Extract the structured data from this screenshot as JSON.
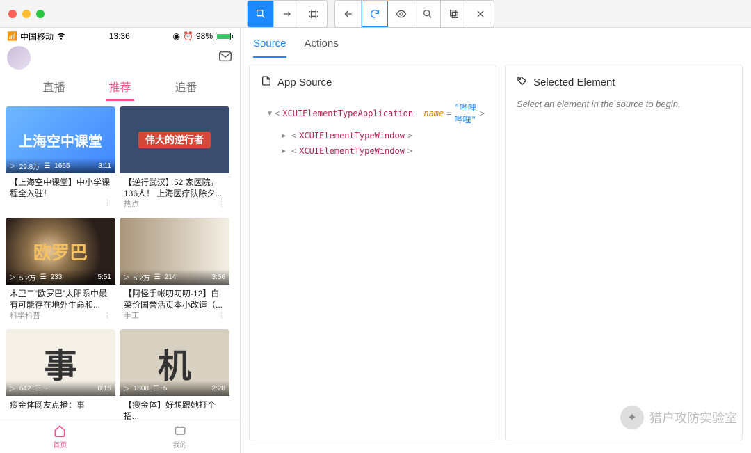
{
  "status": {
    "carrier": "中国移动",
    "time": "13:36",
    "battery_pct": "98%"
  },
  "phone_tabs": {
    "live": "直播",
    "rec": "推荐",
    "follow": "追番"
  },
  "cards": [
    {
      "thumb_text": "上海空中课堂",
      "views": "29.8万",
      "comments": "1665",
      "dur": "3:11",
      "title": "【上海空中课堂】中小学课程全入驻！",
      "sub": ""
    },
    {
      "banner": "伟大的逆行者",
      "views": "",
      "comments": "",
      "dur": "",
      "title": "【逆行武汉】52 家医院，136人！ 上海医疗队除夕...",
      "sub": "热点"
    },
    {
      "thumb_text": "欧罗巴",
      "views": "5.2万",
      "comments": "233",
      "dur": "5:51",
      "title": "木卫二“欧罗巴”太阳系中最有可能存在地外生命和...",
      "sub": "科学科普"
    },
    {
      "views": "5.2万",
      "comments": "214",
      "dur": "3:56",
      "title": "【阿怪手帐叨叨叨-12】白菜价国誉活页本小改造（...",
      "sub": "手工"
    },
    {
      "calli": "事",
      "views": "642",
      "comments": "-",
      "dur": "0:15",
      "title": "瘦金体网友点播：事",
      "sub": ""
    },
    {
      "calli": "机",
      "views": "1808",
      "comments": "5",
      "dur": "2:28",
      "title": "【瘦金体】好想跟她打个招...",
      "sub": ""
    }
  ],
  "bottom_nav": {
    "home": "首页",
    "mine": "我的"
  },
  "right_tabs": {
    "source": "Source",
    "actions": "Actions"
  },
  "app_source": {
    "heading": "App Source",
    "root": {
      "tag": "XCUIElementTypeApplication",
      "attr": "name",
      "val": "\"哔哩哔哩\""
    },
    "children": [
      {
        "tag": "XCUIElementTypeWindow"
      },
      {
        "tag": "XCUIElementTypeWindow"
      }
    ]
  },
  "selected": {
    "heading": "Selected Element",
    "hint": "Select an element in the source to begin."
  },
  "watermark": "猎户攻防实验室"
}
